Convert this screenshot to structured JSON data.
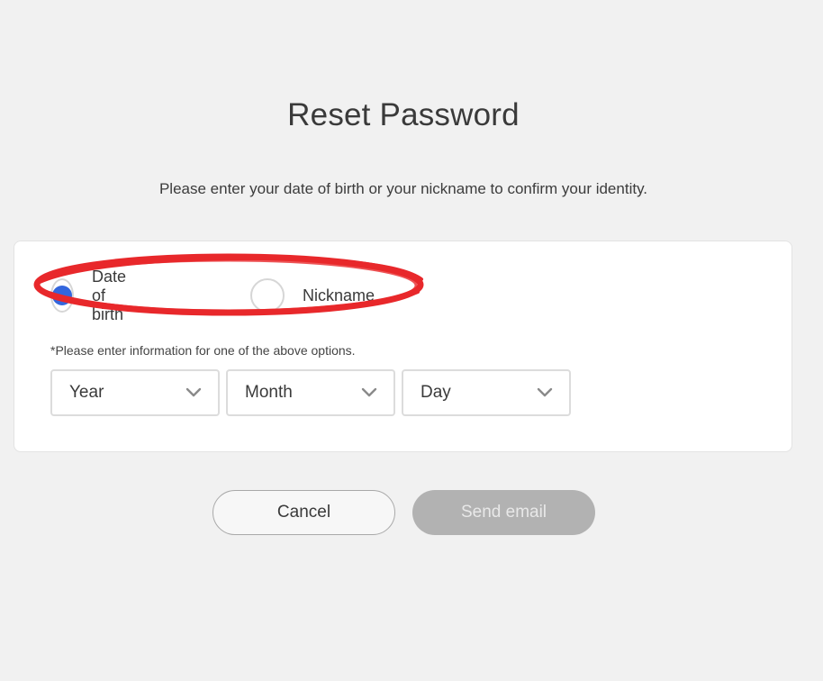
{
  "page": {
    "title": "Reset Password",
    "subtitle": "Please enter your date of birth or your nickname to confirm your identity."
  },
  "identity_options": {
    "selected": "Date of birth",
    "options": [
      {
        "label": "Date of birth",
        "selected": true
      },
      {
        "label": "Nickname",
        "selected": false
      }
    ],
    "hint": "*Please enter information for one of the above options."
  },
  "birth_date": {
    "year": {
      "value": "Year"
    },
    "month": {
      "value": "Month"
    },
    "day": {
      "value": "Day"
    }
  },
  "actions": {
    "cancel_label": "Cancel",
    "send_label": "Send email",
    "send_enabled": false
  },
  "colors": {
    "accent": "#3366dd",
    "annotation": "#e8282b",
    "disabled_button": "#b2b2b2",
    "background": "#f1f1f1"
  },
  "icons": {
    "dropdown": "chevron-down-icon"
  }
}
